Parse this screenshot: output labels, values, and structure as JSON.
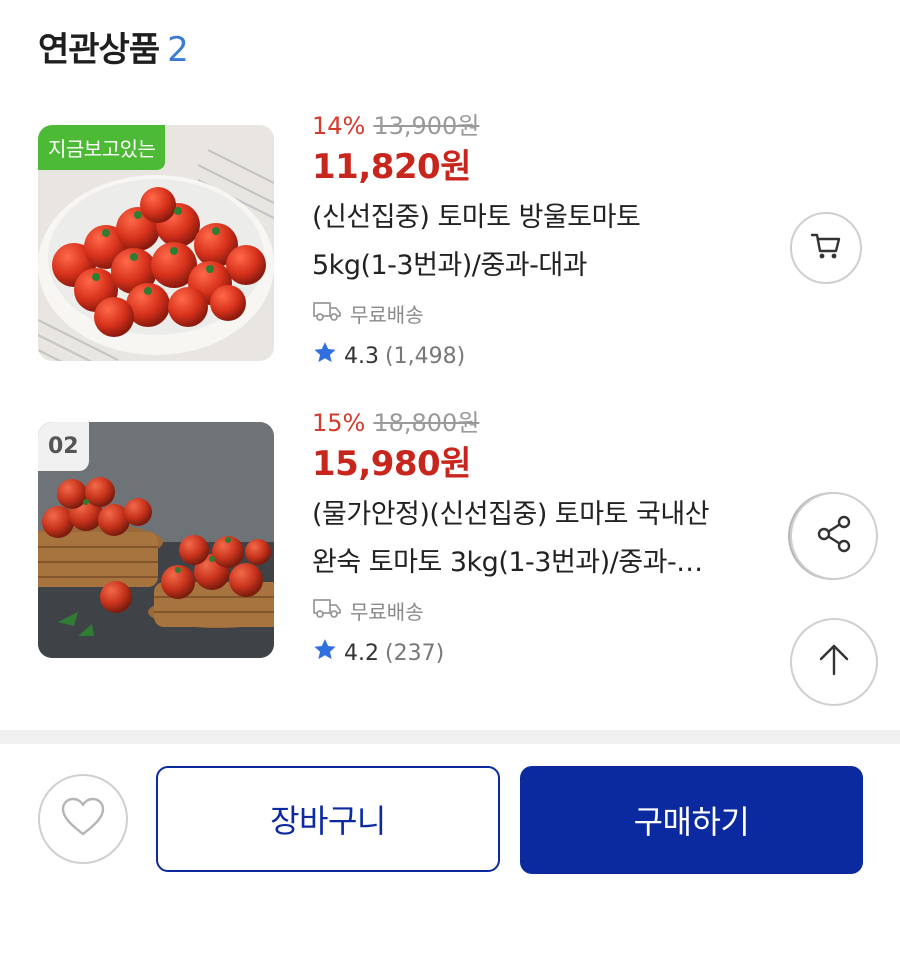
{
  "section": {
    "title": "연관상품",
    "count": "2"
  },
  "products": [
    {
      "badge": "지금보고있는",
      "discount": "14%",
      "original_price": "13,900원",
      "sale_price": "11,820원",
      "name_line1": "(신선집중) 토마토 방울토마토",
      "name_line2": "5kg(1-3번과)/중과-대과",
      "shipping": "무료배송",
      "rating": "4.3",
      "review_count": "(1,498)",
      "image_icon": "cherry-tomato-bowl-photo"
    },
    {
      "badge": "02",
      "discount": "15%",
      "original_price": "18,800원",
      "sale_price": "15,980원",
      "name_line1": "(물가안정)(신선집중) 토마토 국내산",
      "name_line2": "완숙 토마토 3kg(1-3번과)/중과-…",
      "shipping": "무료배송",
      "rating": "4.2",
      "review_count": "(237)",
      "image_icon": "tomato-basket-photo"
    }
  ],
  "actions": {
    "cart_label": "장바구니",
    "buy_label": "구매하기"
  },
  "icons": {
    "cart": "cart-icon",
    "share": "share-icon",
    "top": "arrow-up-icon",
    "like": "heart-icon",
    "truck": "truck-icon",
    "star": "star-icon"
  },
  "colors": {
    "discount": "#d33b2c",
    "sale_price": "#c8261d",
    "brand": "#0b2aa0",
    "badge_green": "#4cba35",
    "star": "#2f6fe0",
    "count_blue": "#3a7bd5"
  }
}
